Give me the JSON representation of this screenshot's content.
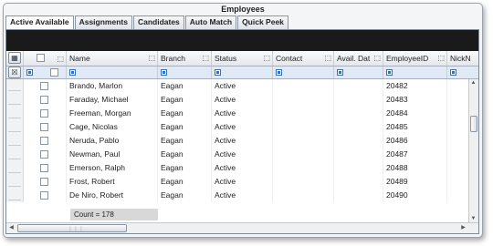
{
  "window": {
    "title": "Employees"
  },
  "tabs": [
    "Active Available",
    "Assignments",
    "Candidates",
    "Auto Match",
    "Quick Peek"
  ],
  "active_tab": "Active Available",
  "grid": {
    "columns": [
      "Name",
      "Branch",
      "Status",
      "Contact",
      "Avail. Dat",
      "EmployeeID",
      "NickN"
    ],
    "rows": [
      {
        "name": "Brando, Marlon",
        "branch": "Eagan",
        "status": "Active",
        "contact": "",
        "avail": "",
        "id": "20482"
      },
      {
        "name": "Faraday, Michael",
        "branch": "Eagan",
        "status": "Active",
        "contact": "",
        "avail": "",
        "id": "20483"
      },
      {
        "name": "Freeman, Morgan",
        "branch": "Eagan",
        "status": "Active",
        "contact": "",
        "avail": "",
        "id": "20484"
      },
      {
        "name": "Cage, Nicolas",
        "branch": "Eagan",
        "status": "Active",
        "contact": "",
        "avail": "",
        "id": "20485"
      },
      {
        "name": "Neruda, Pablo",
        "branch": "Eagan",
        "status": "Active",
        "contact": "",
        "avail": "",
        "id": "20486"
      },
      {
        "name": "Newman, Paul",
        "branch": "Eagan",
        "status": "Active",
        "contact": "",
        "avail": "",
        "id": "20487"
      },
      {
        "name": "Emerson, Ralph",
        "branch": "Eagan",
        "status": "Active",
        "contact": "",
        "avail": "",
        "id": "20488"
      },
      {
        "name": "Frost, Robert",
        "branch": "Eagan",
        "status": "Active",
        "contact": "",
        "avail": "",
        "id": "20489"
      },
      {
        "name": "De Niro, Robert",
        "branch": "Eagan",
        "status": "Active",
        "contact": "",
        "avail": "",
        "id": "20490"
      }
    ],
    "count_label": "Count = 178"
  },
  "icons": {
    "pin": "pin-icon",
    "column_chooser": "column-chooser-icon",
    "clear_filter": "clear-filter-icon",
    "filter": "filter-icon"
  },
  "colors": {
    "group_bar": "#1a1a1a",
    "filter_row": "#dfeaf6",
    "filter_icon": "#3a6fb4",
    "summary": "#d8d8d8"
  }
}
